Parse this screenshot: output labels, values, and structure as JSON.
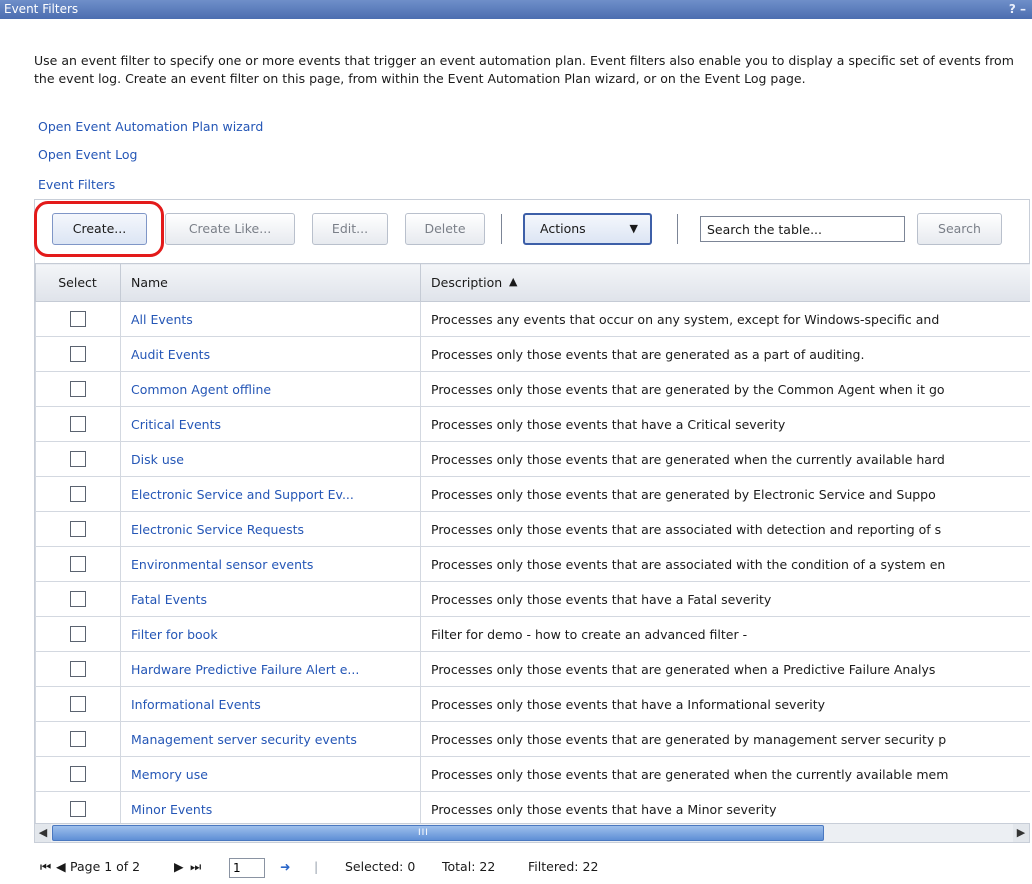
{
  "window": {
    "title": "Event Filters",
    "help_icon": "?",
    "minimize_icon": "–"
  },
  "intro": {
    "text": "Use an event filter to specify one or more events that trigger an event automation plan. Event filters also enable you to display a specific set of events from the event log. Create an event filter on this page, from within the Event Automation Plan wizard, or on the Event Log page."
  },
  "links": {
    "wizard": "Open Event Automation Plan wizard",
    "event_log": "Open Event Log",
    "event_filters": "Event Filters"
  },
  "toolbar": {
    "create": "Create...",
    "create_like": "Create Like...",
    "edit": "Edit...",
    "delete": "Delete",
    "actions": "Actions",
    "search_placeholder": "Search the table...",
    "search_button": "Search"
  },
  "table": {
    "columns": [
      "Select",
      "Name",
      "Description"
    ],
    "rows": [
      {
        "name": "All Events",
        "description": "Processes any events that occur on any system, except for Windows-specific and"
      },
      {
        "name": "Audit Events",
        "description": "Processes only those events that are generated as a part of auditing."
      },
      {
        "name": "Common Agent offline",
        "description": "Processes only those events that are generated by the Common Agent when it go"
      },
      {
        "name": "Critical Events",
        "description": "Processes only those events that have a Critical severity"
      },
      {
        "name": "Disk use",
        "description": "Processes only those events that are generated when the currently available hard"
      },
      {
        "name": "Electronic Service and Support Ev...",
        "description": "Processes only those events that are generated by Electronic Service and Suppo"
      },
      {
        "name": "Electronic Service Requests",
        "description": "Processes only those events that are associated with detection and reporting of s"
      },
      {
        "name": "Environmental sensor events",
        "description": "Processes only those events that are associated with the condition of a system en"
      },
      {
        "name": "Fatal Events",
        "description": "Processes only those events that have a Fatal severity"
      },
      {
        "name": "Filter for book",
        "description": "Filter for demo - how to create an advanced filter -"
      },
      {
        "name": "Hardware Predictive Failure Alert e...",
        "description": "Processes only those events that are generated when a Predictive Failure Analys"
      },
      {
        "name": "Informational Events",
        "description": "Processes only those events that have a Informational severity"
      },
      {
        "name": "Management server security events",
        "description": "Processes only those events that are generated by management server security p"
      },
      {
        "name": "Memory use",
        "description": "Processes only those events that are generated when the currently available mem"
      },
      {
        "name": "Minor Events",
        "description": "Processes only those events that have a Minor severity"
      }
    ]
  },
  "pager": {
    "page_label": "Page 1 of 2",
    "page_value": "1",
    "selected": "Selected: 0",
    "total": "Total: 22",
    "filtered": "Filtered: 22"
  }
}
